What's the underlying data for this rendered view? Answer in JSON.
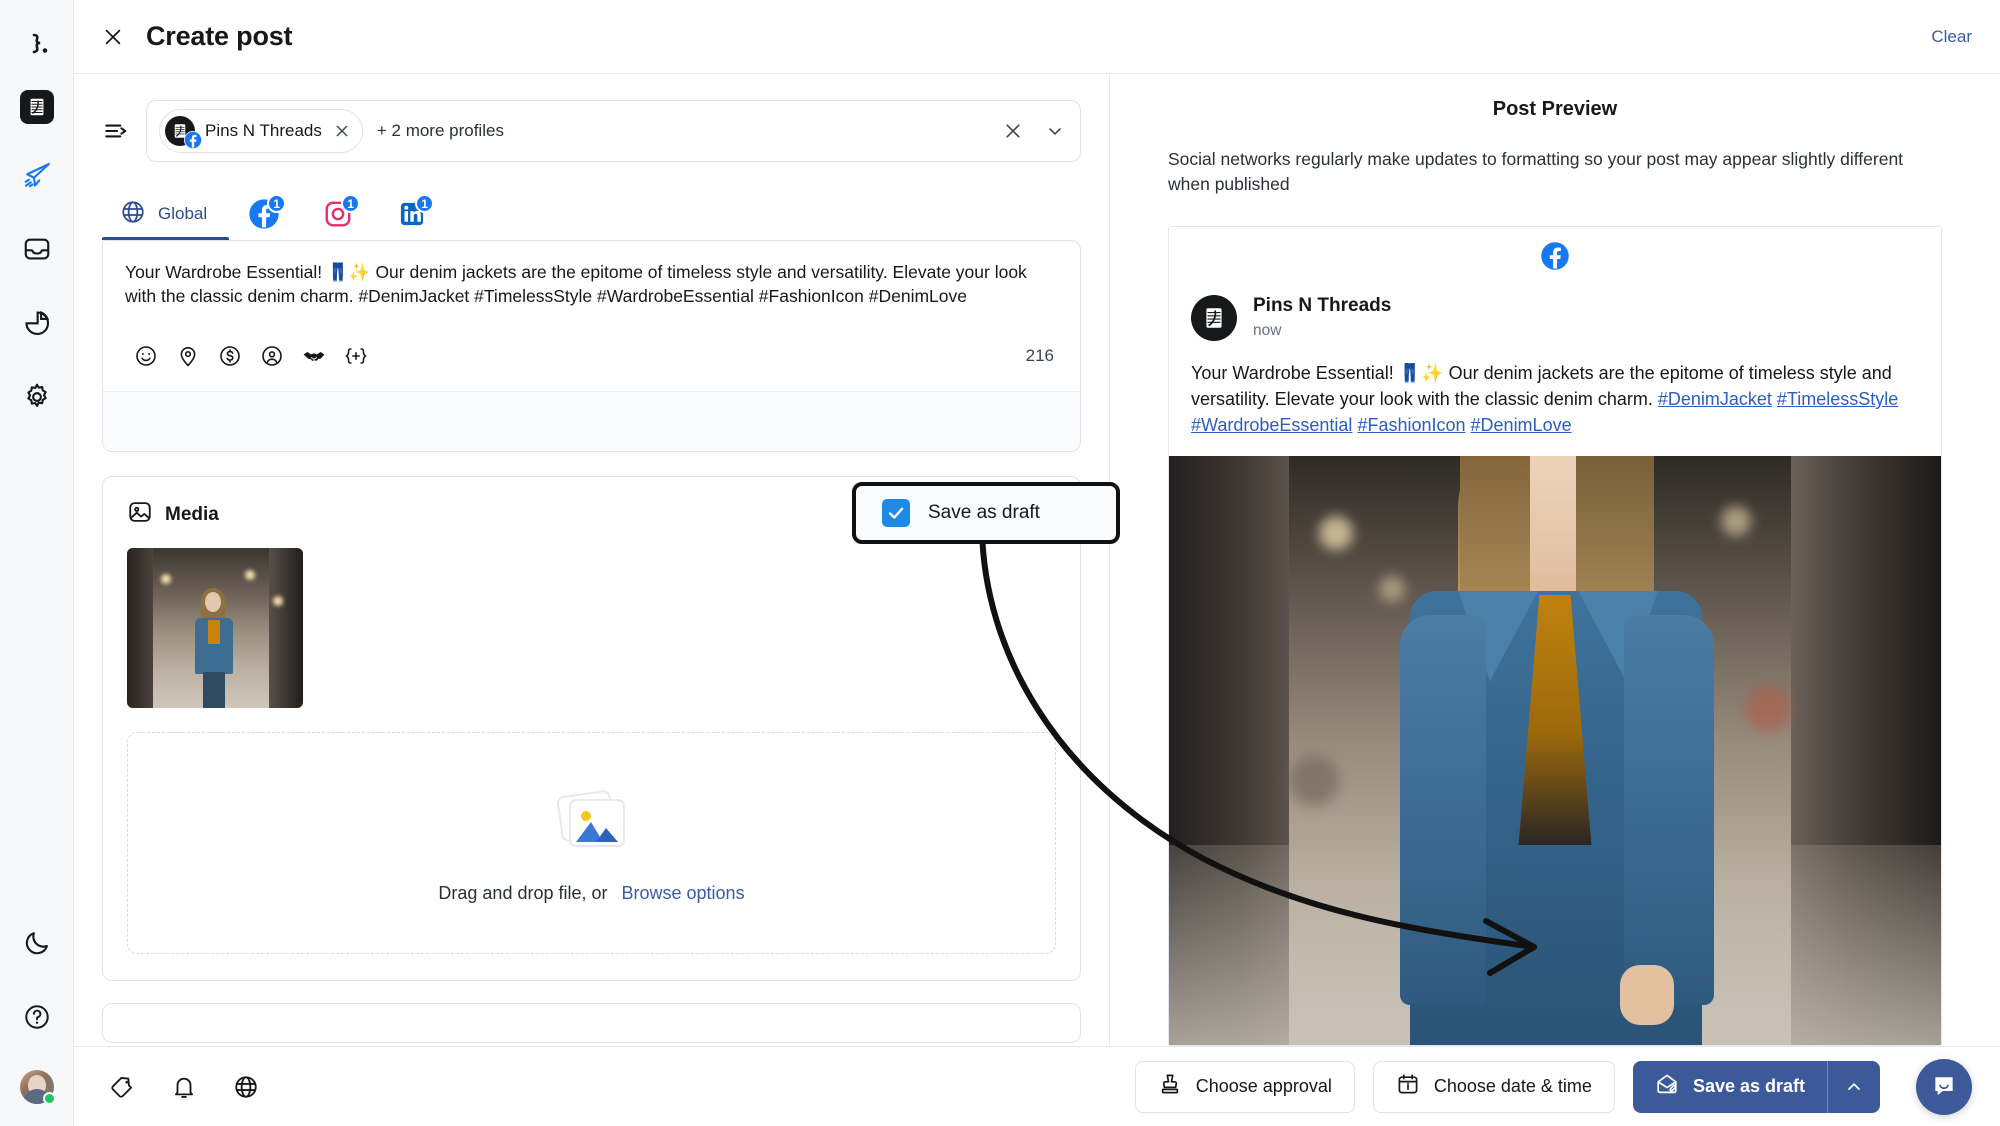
{
  "sidebar": {
    "items": [
      {
        "name": "logo",
        "label": "Brand logo"
      },
      {
        "name": "workspace",
        "label": "Pins N Threads workspace"
      },
      {
        "name": "publish",
        "label": "Publish"
      },
      {
        "name": "inbox",
        "label": "Inbox"
      },
      {
        "name": "analytics",
        "label": "Analytics"
      },
      {
        "name": "settings",
        "label": "Settings"
      }
    ],
    "bottom": [
      {
        "name": "dark-mode",
        "label": "Dark mode"
      },
      {
        "name": "help",
        "label": "Help"
      },
      {
        "name": "account",
        "label": "Account"
      }
    ]
  },
  "header": {
    "title": "Create post",
    "close_label": "×",
    "clear_label": "Clear"
  },
  "profiles": {
    "selected_chip": "Pins N Threads",
    "more_label": "+ 2 more profiles",
    "remove_chip_label": "×",
    "clear_all_label": "×"
  },
  "tabs": [
    {
      "label": "Global",
      "icon": "globe-icon",
      "badge": "",
      "active": true
    },
    {
      "label": "",
      "icon": "facebook-icon",
      "badge": "1",
      "active": false
    },
    {
      "label": "",
      "icon": "instagram-icon",
      "badge": "1",
      "active": false
    },
    {
      "label": "",
      "icon": "linkedin-icon",
      "badge": "1",
      "active": false
    }
  ],
  "editor": {
    "text": "Your Wardrobe Essential! 👖✨ Our denim jackets are the epitome of timeless style and versatility. Elevate your look with the classic denim charm. #DenimJacket #TimelessStyle #WardrobeEssential #FashionIcon #DenimLove",
    "char_count": "216",
    "tools": [
      {
        "name": "emoji-icon",
        "label": "Emoji"
      },
      {
        "name": "location-pin-icon",
        "label": "Location"
      },
      {
        "name": "dollar-icon",
        "label": "Product tag"
      },
      {
        "name": "mention-icon",
        "label": "Mention"
      },
      {
        "name": "handshake-icon",
        "label": "Collaboration"
      },
      {
        "name": "variable-icon",
        "label": "{+}"
      }
    ]
  },
  "callout": {
    "label": "Save as draft",
    "checked": true
  },
  "media": {
    "title": "Media",
    "dropzone_text": "Drag and drop file, or",
    "browse_label": "Browse options"
  },
  "preview": {
    "title": "Post Preview",
    "note": "Social networks regularly make updates to formatting so your post may appear slightly different when published",
    "network": "facebook-icon",
    "author": "Pins N Threads",
    "time": "now",
    "body_plain": "Your Wardrobe Essential! 👖✨ Our denim jackets are the epitome of timeless style and versatility. Elevate your look with the classic denim charm. ",
    "hashtags": [
      "#DenimJacket",
      "#TimelessStyle",
      "#WardrobeEssential",
      "#FashionIcon",
      "#DenimLove"
    ]
  },
  "bottombar": {
    "icons": [
      {
        "name": "tag-icon",
        "label": "Tags"
      },
      {
        "name": "bell-icon",
        "label": "Notifications"
      },
      {
        "name": "globe-icon",
        "label": "Language"
      }
    ],
    "approval_label": "Choose approval",
    "datetime_label": "Choose date & time",
    "primary_label": "Save as draft",
    "chat_label": "Open chat"
  },
  "colors": {
    "accent": "#3c5a9a",
    "link": "#3b5ba9",
    "facebook": "#1878f2",
    "instagram": "#e1306c",
    "linkedin": "#0a66c2",
    "checkbox": "#1e8ae8",
    "tab_underline": "#2d4b8e",
    "online": "#22c55e"
  }
}
